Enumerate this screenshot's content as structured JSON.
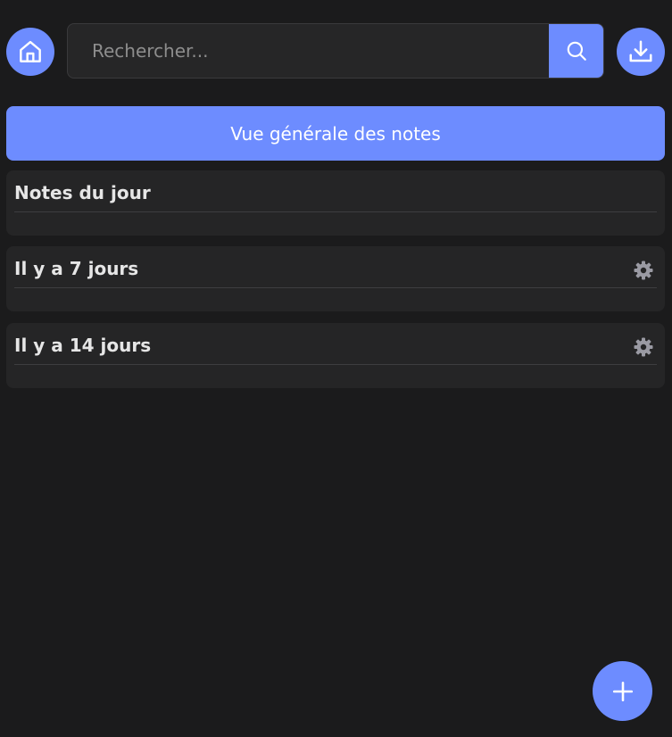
{
  "header": {
    "home_icon": "home-icon",
    "search": {
      "placeholder": "Rechercher...",
      "value": "",
      "button_icon": "search-icon"
    },
    "download_icon": "download-icon"
  },
  "overview_button": {
    "label": "Vue générale des notes"
  },
  "sections": [
    {
      "title": "Notes du jour",
      "has_settings": false
    },
    {
      "title": "Il y a 7 jours",
      "has_settings": true,
      "settings_icon": "gear-icon"
    },
    {
      "title": "Il y a 14 jours",
      "has_settings": true,
      "settings_icon": "gear-icon"
    }
  ],
  "fab": {
    "label": "+",
    "icon": "plus-icon"
  },
  "colors": {
    "accent": "#6d8cff",
    "background": "#1b1b1c",
    "card": "#252526",
    "gear": "#9a9aa3"
  }
}
